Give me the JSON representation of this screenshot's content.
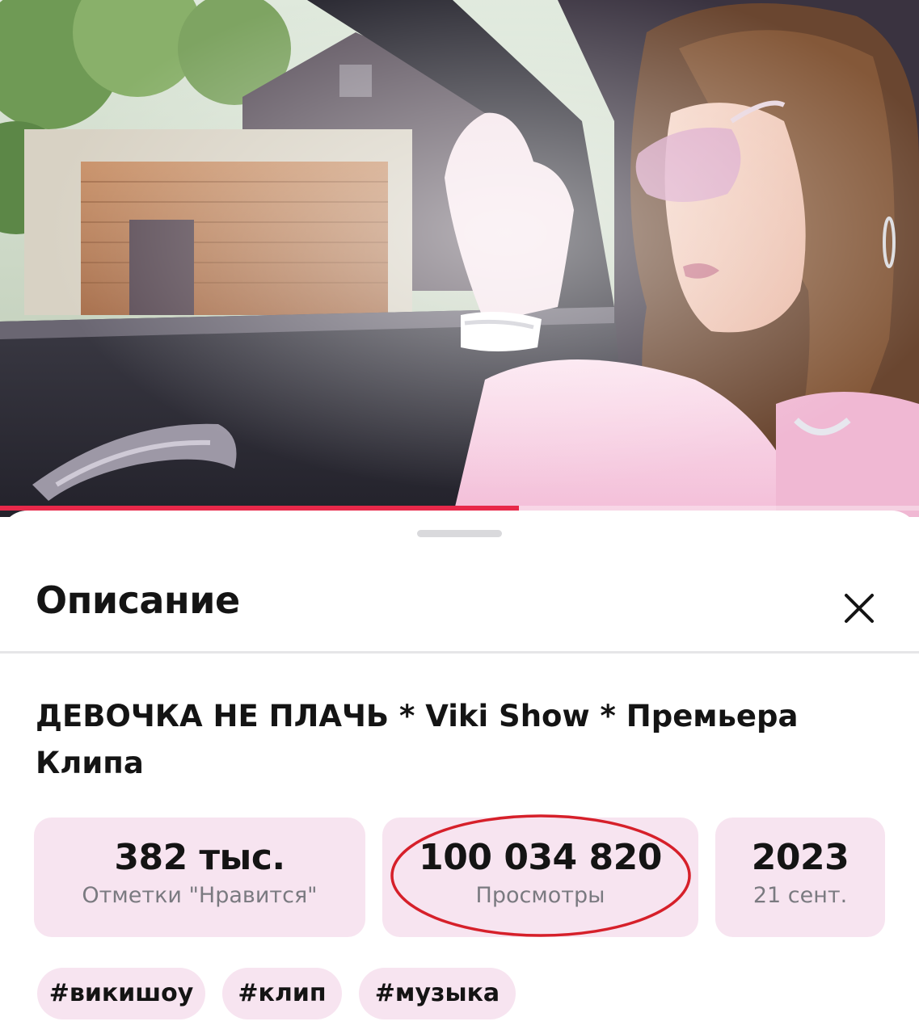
{
  "video": {
    "progress_fraction": 0.565,
    "accent_color": "#e8294a"
  },
  "sheet": {
    "title": "Описание",
    "close_icon": "close-icon"
  },
  "video_info": {
    "title": "ДЕВОЧКА НЕ ПЛАЧЬ * Viki Show * Премьера Клипа"
  },
  "stats": [
    {
      "value": "382 тыс.",
      "label": "Отметки \"Нравится\""
    },
    {
      "value": "100 034 820",
      "label": "Просмотры"
    },
    {
      "value": "2023",
      "label": "21 сент."
    }
  ],
  "tags": [
    "#викишоу",
    "#клип",
    "#музыка"
  ],
  "colors": {
    "chip_background": "#f7e4f0",
    "highlight_circle": "#d6202a"
  }
}
